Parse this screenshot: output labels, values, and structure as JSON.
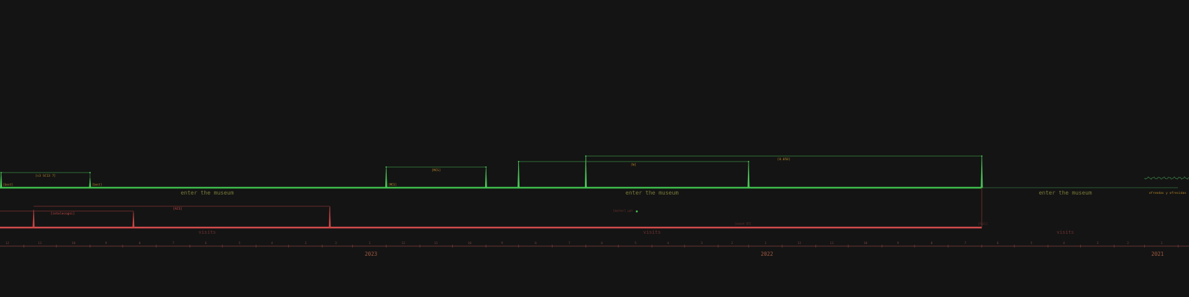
{
  "colors": {
    "background": "#141414",
    "enter_track": "#3dbd4a",
    "enter_spike": "#49c556",
    "enter_bracket": "#2e6e36",
    "enter_text": "#7a7a3a",
    "visit_track": "#d24a4a",
    "visit_spike": "#c84444",
    "visit_bracket": "#6a2a2a",
    "visit_text": "#6e3030",
    "axis": "#6a3434",
    "month_text": "#7a4040",
    "year_text": "#a05a40",
    "future_line": "#2a5a32",
    "wave": "#3a7a42",
    "extra_label": "#b8892a"
  },
  "chart_data": {
    "type": "timeline",
    "direction": "right-to-left",
    "x_range": [
      "2020-12-22",
      "2023-12-23"
    ],
    "years": [
      "2023",
      "2022",
      "2021"
    ],
    "month_labels": [
      "12",
      "11",
      "10",
      "9",
      "8",
      "7",
      "6",
      "5",
      "4",
      "3",
      "2",
      "1",
      "12",
      "11",
      "10",
      "9",
      "8",
      "7",
      "6",
      "5",
      "4",
      "3",
      "2",
      "1",
      "12",
      "11",
      "10",
      "9",
      "8",
      "7",
      "6",
      "5",
      "4",
      "3",
      "2",
      "1"
    ],
    "enter_track": {
      "start": "2021-07-01",
      "end": "2023-12-23",
      "labels": [
        "enter the museum",
        "enter the museum",
        "enter the museum"
      ],
      "spikes": [
        {
          "date": "2023-12-22",
          "height": 22,
          "label": "[best]"
        },
        {
          "date": "2023-10-01",
          "height": 14,
          "label": "[best]"
        },
        {
          "date": "2023-01-01",
          "height": 28,
          "label": "[MCS]"
        },
        {
          "date": "2022-10-01",
          "height": 28,
          "label": ""
        },
        {
          "date": "2022-09-01",
          "height": 38,
          "label": ""
        },
        {
          "date": "2022-07-01",
          "height": 46,
          "label": ""
        },
        {
          "date": "2022-02-01",
          "height": 38,
          "label": ""
        },
        {
          "date": "2021-07-01",
          "height": 46,
          "label": ""
        }
      ],
      "brackets": [
        {
          "from": "2023-12-22",
          "to": "2023-10-01",
          "level": 22,
          "label": "[s3 SC13 7]"
        },
        {
          "from": "2023-01-01",
          "to": "2022-10-01",
          "level": 30,
          "label": "[MCS]"
        },
        {
          "from": "2022-09-01",
          "to": "2022-02-01",
          "level": 38,
          "label": "[W]"
        },
        {
          "from": "2022-07-01",
          "to": "2021-07-01",
          "level": 46,
          "label": "[0.058]"
        }
      ],
      "wave_start": "2021-02-01",
      "wave_end": "2020-12-22",
      "extra_label": "ofrendas y ofrecidas"
    },
    "visit_track": {
      "start": "2021-07-01",
      "end": "2023-12-23",
      "labels": [
        "visits",
        "visits",
        "visits"
      ],
      "spikes": [
        {
          "date": "2023-11-22",
          "height": 26,
          "label": ""
        },
        {
          "date": "2023-08-22",
          "height": 22,
          "label": ""
        },
        {
          "date": "2023-02-22",
          "height": 30,
          "label": ""
        }
      ],
      "brackets": [
        {
          "from": "2023-11-22",
          "to": "2023-02-22",
          "level": 31,
          "label": "[ACS]"
        },
        {
          "from": "2023-12-23",
          "to": "2023-08-22",
          "level": 24,
          "label": "[intelecogni]"
        }
      ],
      "note_labels": [
        {
          "date": "2022-02-01",
          "label": "[event DT]"
        },
        {
          "date": "2021-06-25",
          "label": "[fail]"
        }
      ]
    },
    "floating_marker": {
      "date": "2022-05-15",
      "label": "[marker] ppt"
    }
  }
}
